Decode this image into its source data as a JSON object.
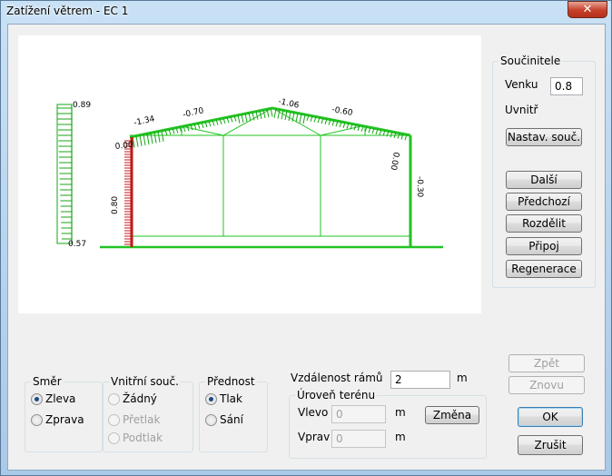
{
  "window": {
    "title": "Zatížení větrem - EC 1",
    "close_glyph": "✕"
  },
  "diagram": {
    "left_profile": {
      "top_value": "0.89",
      "bottom_value": "0.57"
    },
    "labels": {
      "roof_left_edge": "-1.34",
      "roof_left_mid": "-0.70",
      "roof_ridge": "-1.06",
      "roof_right_mid": "-0.60",
      "eave_left": "0.00",
      "eave_right": "0.00",
      "wall_left": "0.80",
      "wall_right": "-0.30"
    },
    "colors": {
      "load": "#14a614",
      "structure": "#22c322",
      "wall_left": "#c21818"
    }
  },
  "soucinitele": {
    "legend": "Součinitele",
    "venku_label": "Venku",
    "venku_value": "0.8",
    "uvnitr_label": "Uvnitř",
    "nastav_button": "Nastav. souč."
  },
  "nav_buttons": {
    "dalsi": "Další",
    "predchozi": "Předchozí",
    "rozdelit": "Rozdělit",
    "pripoj": "Připoj",
    "regenerace": "Regenerace"
  },
  "smer": {
    "legend": "Směr",
    "options": [
      "Zleva",
      "Zprava"
    ],
    "selected": "Zleva"
  },
  "vnitrni": {
    "legend": "Vnitřní souč.",
    "options": [
      "Žádný",
      "Přetlak",
      "Podtlak"
    ],
    "selected": "Žádný"
  },
  "prednost": {
    "legend": "Přednost",
    "options": [
      "Tlak",
      "Sání"
    ],
    "selected": "Tlak"
  },
  "vzdalenost": {
    "label": "Vzdálenost rámů",
    "value": "2",
    "unit": "m"
  },
  "teren": {
    "legend": "Úroveň terénu",
    "vlevo_label": "Vlevo",
    "vlevo_value": "0",
    "vprav_label": "Vprav",
    "vprav_value": "0",
    "unit": "m",
    "zmena_button": "Změna"
  },
  "actions": {
    "zpet": "Zpět",
    "znovu": "Znovu",
    "ok": "OK",
    "zrusit": "Zrušit"
  }
}
